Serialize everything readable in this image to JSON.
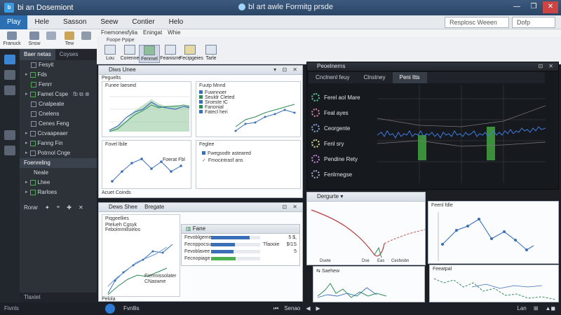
{
  "window": {
    "title": "bi an Dosemiont",
    "center_title": "bl art awle Formitg prsde",
    "controls": [
      "—",
      "❐",
      "✕"
    ]
  },
  "menu": {
    "items": [
      "Play",
      "Hele",
      "Sasson",
      "Seew",
      "Contier",
      "Helo"
    ],
    "search1": "Resplosc Weeen",
    "search2": "Dofp"
  },
  "ribbon": {
    "buttons": [
      "Franuck",
      "Snsw",
      "",
      "Tew",
      "",
      ""
    ],
    "tabs": [
      "Fnemonesfylia",
      "Eningat",
      "Whie"
    ],
    "group_label": "Foope Ppipe",
    "tools": [
      "Lou",
      "Corenne",
      "Fenrnel",
      "Feanisrre",
      "Fecipgeies",
      "Tarle"
    ]
  },
  "sidebar": {
    "tabs": [
      "Baer netas",
      "Coyses"
    ],
    "items": [
      {
        "label": "Fesyit",
        "check": false,
        "tri": false
      },
      {
        "label": "Fds",
        "check": true,
        "tri": true
      },
      {
        "label": "Fenrr",
        "check": true,
        "tri": false
      },
      {
        "label": "Famet Cspe",
        "check": true,
        "tri": true,
        "extra": "fb ⧉ ⊗"
      },
      {
        "label": "Cnalpeate",
        "check": false,
        "tri": false
      },
      {
        "label": "Cnelens",
        "check": false,
        "tri": false
      },
      {
        "label": "Cenes Feng",
        "check": false,
        "tri": false
      },
      {
        "label": "Ccvaapeaer",
        "check": false,
        "tri": true
      },
      {
        "label": "Fanng Fin",
        "check": true,
        "tri": true
      },
      {
        "label": "Potrnol Cnge",
        "check": false,
        "tri": true
      }
    ],
    "section": "Foenreling",
    "sub_items": [
      "Neale",
      "Lhee",
      "Rarloes"
    ],
    "toolrow_label": "Rorar",
    "toolrow_icons": [
      "✦",
      "⌖",
      "✚",
      "✕"
    ],
    "bottom": "Tlaxiet"
  },
  "panels": {
    "p1": {
      "title": "Diws Unee",
      "side_label": "Peguelts",
      "caption": "Acuet Coinds"
    },
    "p1a": {
      "title": "Funee laeseid"
    },
    "p1b": {
      "title": "Fovel lbile",
      "note": "Foerat Fbl"
    },
    "p1c": {
      "title": "Fuutp Mnnd",
      "legend": [
        "Fuwnnoer",
        "Seuldr Cleted",
        "Sroeste tC",
        "Fanonial",
        "Fatecl heri"
      ]
    },
    "p1d": {
      "title": "Feglee",
      "items": [
        "Fwegsodtr asteared",
        "Fmocintrasf ans"
      ]
    },
    "p2": {
      "title": "Peoelnerns",
      "tabs": [
        "Cnclnenl feuy",
        "Clnstney",
        "Peni Itts"
      ],
      "legend": [
        "Ferel aol Mare",
        "Feal ayes",
        "Ceorgente",
        "Fenl sry",
        "Pendine Rety",
        "Fenlrnegse"
      ]
    },
    "p3": {
      "title": "Dews Shee",
      "title2": "Bregate",
      "side": "Piqgeellies",
      "sub": "Ptelueh Cgsyk",
      "rows": [
        "Febolmmllsielos",
        "Fengleroce"
      ],
      "callout": "Fiemnissolater\nCNaswne",
      "footer": "Pelola"
    },
    "p4": {
      "title": "Fane",
      "rows": [
        {
          "label": "Fevoblgeme",
          "fill": 0.78,
          "value": ""
        },
        {
          "label": "Fecnppocsue",
          "fill": 0.48,
          "value": "Tfaooie"
        },
        {
          "label": "Fevoblavee",
          "fill": 0.46,
          "value": ""
        },
        {
          "label": "Fecnopiage",
          "fill": 0.5,
          "value": ""
        }
      ],
      "values_right": [
        "5 $,",
        "$!1S",
        "5"
      ]
    },
    "p5": {
      "title": "Dergurte",
      "xaxis": [
        "Dsete",
        "Dse",
        "Eas",
        "Cesfesbn"
      ]
    },
    "p6": {
      "title": "Feenl fdle"
    },
    "p7": {
      "title": "Saehew"
    },
    "p8": {
      "title": "Feeatpal"
    }
  },
  "status": {
    "left": "Fivnls",
    "center_label": "Fvnllis",
    "mid": [
      "⏮",
      "Senao",
      "◀",
      "▶"
    ],
    "right": [
      "Lan",
      "⊞",
      "▲◼"
    ]
  }
}
